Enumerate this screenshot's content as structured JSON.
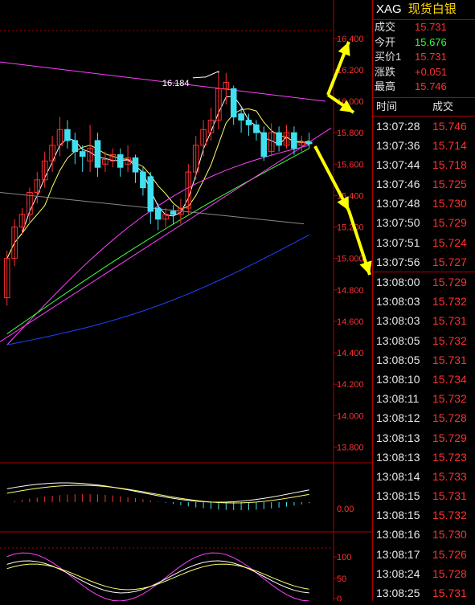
{
  "header": {
    "code": "XAG",
    "name": "现货白银"
  },
  "quote": [
    {
      "label": "成交",
      "value": "15.731",
      "color": "#ff3030"
    },
    {
      "label": "今开",
      "value": "15.676",
      "color": "#30ff30"
    },
    {
      "label": "买价1",
      "value": "15.731",
      "color": "#ff3030"
    },
    {
      "label": "涨跌",
      "value": "+0.051",
      "color": "#ff3030"
    },
    {
      "label": "最高",
      "value": "15.746",
      "color": "#ff3030"
    }
  ],
  "ticks_header": {
    "time": "时间",
    "deal": "成交"
  },
  "ticks": [
    {
      "time": "13:07:28",
      "price": "15.746"
    },
    {
      "time": "13:07:36",
      "price": "15.714"
    },
    {
      "time": "13:07:44",
      "price": "15.718"
    },
    {
      "time": "13:07:46",
      "price": "15.725"
    },
    {
      "time": "13:07:48",
      "price": "15.730"
    },
    {
      "time": "13:07:50",
      "price": "15.729"
    },
    {
      "time": "13:07:51",
      "price": "15.724"
    },
    {
      "time": "13:07:56",
      "price": "15.727"
    },
    {
      "time": "13:08:00",
      "price": "15.729"
    },
    {
      "time": "13:08:03",
      "price": "15.732"
    },
    {
      "time": "13:08:03",
      "price": "15.731"
    },
    {
      "time": "13:08:05",
      "price": "15.732"
    },
    {
      "time": "13:08:05",
      "price": "15.731"
    },
    {
      "time": "13:08:10",
      "price": "15.734"
    },
    {
      "time": "13:08:11",
      "price": "15.732"
    },
    {
      "time": "13:08:12",
      "price": "15.728"
    },
    {
      "time": "13:08:13",
      "price": "15.729"
    },
    {
      "time": "13:08:13",
      "price": "15.723"
    },
    {
      "time": "13:08:14",
      "price": "15.733"
    },
    {
      "time": "13:08:15",
      "price": "15.731"
    },
    {
      "time": "13:08:15",
      "price": "15.732"
    },
    {
      "time": "13:08:16",
      "price": "15.730"
    },
    {
      "time": "13:08:17",
      "price": "15.726"
    },
    {
      "time": "13:08:24",
      "price": "15.728"
    },
    {
      "time": "13:08:25",
      "price": "15.731"
    }
  ],
  "chart_data": {
    "type": "candlestick",
    "price_axis_labels": [
      "16.400",
      "16.200",
      "16.000",
      "15.800",
      "15.600",
      "15.400",
      "15.200",
      "15.000",
      "14.800",
      "14.600",
      "14.400",
      "14.200",
      "14.000",
      "13.800"
    ],
    "ylim": [
      13.7,
      16.45
    ],
    "high_annotation": "16.184",
    "candles": [
      [
        14.75,
        15.0,
        14.7,
        15.05
      ],
      [
        15.0,
        15.2,
        14.95,
        15.25
      ],
      [
        15.2,
        15.28,
        15.15,
        15.32
      ],
      [
        15.28,
        15.42,
        15.22,
        15.45
      ],
      [
        15.42,
        15.5,
        15.35,
        15.55
      ],
      [
        15.5,
        15.62,
        15.45,
        15.68
      ],
      [
        15.62,
        15.72,
        15.55,
        15.78
      ],
      [
        15.72,
        15.82,
        15.65,
        15.9
      ],
      [
        15.82,
        15.75,
        15.7,
        15.88
      ],
      [
        15.75,
        15.68,
        15.6,
        15.8
      ],
      [
        15.68,
        15.65,
        15.55,
        15.72
      ],
      [
        15.62,
        15.7,
        15.55,
        15.85
      ],
      [
        15.75,
        15.58,
        15.52,
        15.8
      ],
      [
        15.6,
        15.63,
        15.55,
        15.68
      ],
      [
        15.62,
        15.66,
        15.58,
        15.7
      ],
      [
        15.66,
        15.58,
        15.52,
        15.7
      ],
      [
        15.6,
        15.64,
        15.55,
        15.72
      ],
      [
        15.64,
        15.55,
        15.48,
        15.66
      ],
      [
        15.55,
        15.45,
        15.4,
        15.58
      ],
      [
        15.52,
        15.3,
        15.22,
        15.55
      ],
      [
        15.32,
        15.25,
        15.18,
        15.35
      ],
      [
        15.25,
        15.28,
        15.2,
        15.32
      ],
      [
        15.3,
        15.28,
        15.22,
        15.34
      ],
      [
        15.28,
        15.32,
        15.22,
        15.38
      ],
      [
        15.32,
        15.55,
        15.28,
        15.6
      ],
      [
        15.55,
        15.72,
        15.5,
        15.78
      ],
      [
        15.72,
        15.82,
        15.65,
        15.88
      ],
      [
        15.8,
        15.88,
        15.75,
        15.96
      ],
      [
        15.88,
        16.08,
        15.82,
        16.18
      ],
      [
        16.08,
        16.12,
        15.98,
        16.18
      ],
      [
        16.08,
        15.9,
        15.85,
        16.1
      ],
      [
        15.92,
        15.88,
        15.8,
        15.96
      ],
      [
        15.88,
        15.85,
        15.78,
        15.92
      ],
      [
        15.85,
        15.8,
        15.75,
        15.88
      ],
      [
        15.8,
        15.65,
        15.62,
        15.84
      ],
      [
        15.68,
        15.8,
        15.65,
        15.86
      ],
      [
        15.8,
        15.72,
        15.68,
        15.84
      ],
      [
        15.72,
        15.8,
        15.7,
        15.85
      ],
      [
        15.8,
        15.7,
        15.66,
        15.84
      ],
      [
        15.72,
        15.74,
        15.68,
        15.78
      ],
      [
        15.74,
        15.73,
        15.7,
        15.8
      ]
    ],
    "macd_zero_label": "0.00",
    "kdj_labels": [
      "100",
      "50",
      "0"
    ]
  },
  "colors": {
    "up": "#ff3030",
    "down": "#40e0f0",
    "grid": "#b00000",
    "axis_text": "#ff3030"
  }
}
